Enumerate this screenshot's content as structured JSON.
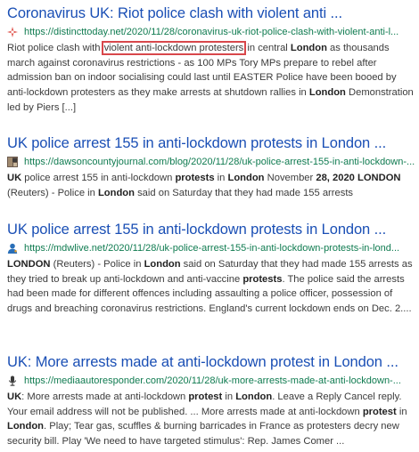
{
  "results": [
    {
      "title": "Coronavirus UK: Riot police clash with violent anti ...",
      "url": "https://distincttoday.net/2020/11/28/coronavirus-uk-riot-police-clash-with-violent-anti-l...",
      "favicon": "compass-icon",
      "snippet": [
        {
          "t": "Riot police clash with "
        },
        {
          "t": "violent anti-lockdown protesters",
          "hl": true
        },
        {
          "t": " in central "
        },
        {
          "t": "London",
          "b": true
        },
        {
          "t": " as thousands march against coronavirus restrictions - as 100 MPs Tory MPs prepare to rebel after admission ban on indoor socialising could last until EASTER Police have been booed by anti-lockdown protesters as they make arrests at shutdown rallies in "
        },
        {
          "t": "London",
          "b": true
        },
        {
          "t": " Demonstration led by Piers [...]"
        }
      ]
    },
    {
      "title": "UK police arrest 155 in anti-lockdown protests in London ...",
      "url": "https://dawsoncountyjournal.com/blog/2020/11/28/uk-police-arrest-155-in-anti-lockdown-...",
      "favicon": "photo-icon",
      "snippet": [
        {
          "t": "UK",
          "b": true
        },
        {
          "t": " police arrest 155 in anti-lockdown "
        },
        {
          "t": "protests",
          "b": true
        },
        {
          "t": " in "
        },
        {
          "t": "London",
          "b": true
        },
        {
          "t": " November "
        },
        {
          "t": "28, 2020 LONDON",
          "b": true
        },
        {
          "t": " (Reuters) - Police in "
        },
        {
          "t": "London",
          "b": true
        },
        {
          "t": " said on Saturday that they had made 155 arrests"
        }
      ]
    },
    {
      "title": "UK police arrest 155 in anti-lockdown protests in London ...",
      "url": "https://mdwlive.net/2020/11/28/uk-police-arrest-155-in-anti-lockdown-protests-in-lond...",
      "favicon": "user-icon",
      "snippet": [
        {
          "t": "LONDON",
          "b": true
        },
        {
          "t": " (Reuters) - Police in "
        },
        {
          "t": "London",
          "b": true
        },
        {
          "t": " said on Saturday that they had made 155 arrests as they tried to break up anti-lockdown and anti-vaccine "
        },
        {
          "t": "protests",
          "b": true
        },
        {
          "t": ". The police said the arrests had been made for different offences including assaulting a police officer, possession of drugs and breaching coronavirus restrictions. England's current lockdown ends on Dec. 2...."
        }
      ]
    },
    {
      "title": "UK: More arrests made at anti-lockdown protest in London ...",
      "url": "https://mediaautoresponder.com/2020/11/28/uk-more-arrests-made-at-anti-lockdown-...",
      "favicon": "microphone-icon",
      "snippet": [
        {
          "t": "UK",
          "b": true
        },
        {
          "t": ": More arrests made at anti-lockdown "
        },
        {
          "t": "protest",
          "b": true
        },
        {
          "t": " in "
        },
        {
          "t": "London",
          "b": true
        },
        {
          "t": ". Leave a Reply Cancel reply. Your email address will not be published. ... More arrests made at anti-lockdown "
        },
        {
          "t": "protest",
          "b": true
        },
        {
          "t": " in "
        },
        {
          "t": "London",
          "b": true
        },
        {
          "t": ". Play; Tear gas, scuffles & burning barricades in France as protesters decry new security bill. Play 'We need to have targeted stimulus': Rep. James Comer ..."
        }
      ]
    }
  ]
}
